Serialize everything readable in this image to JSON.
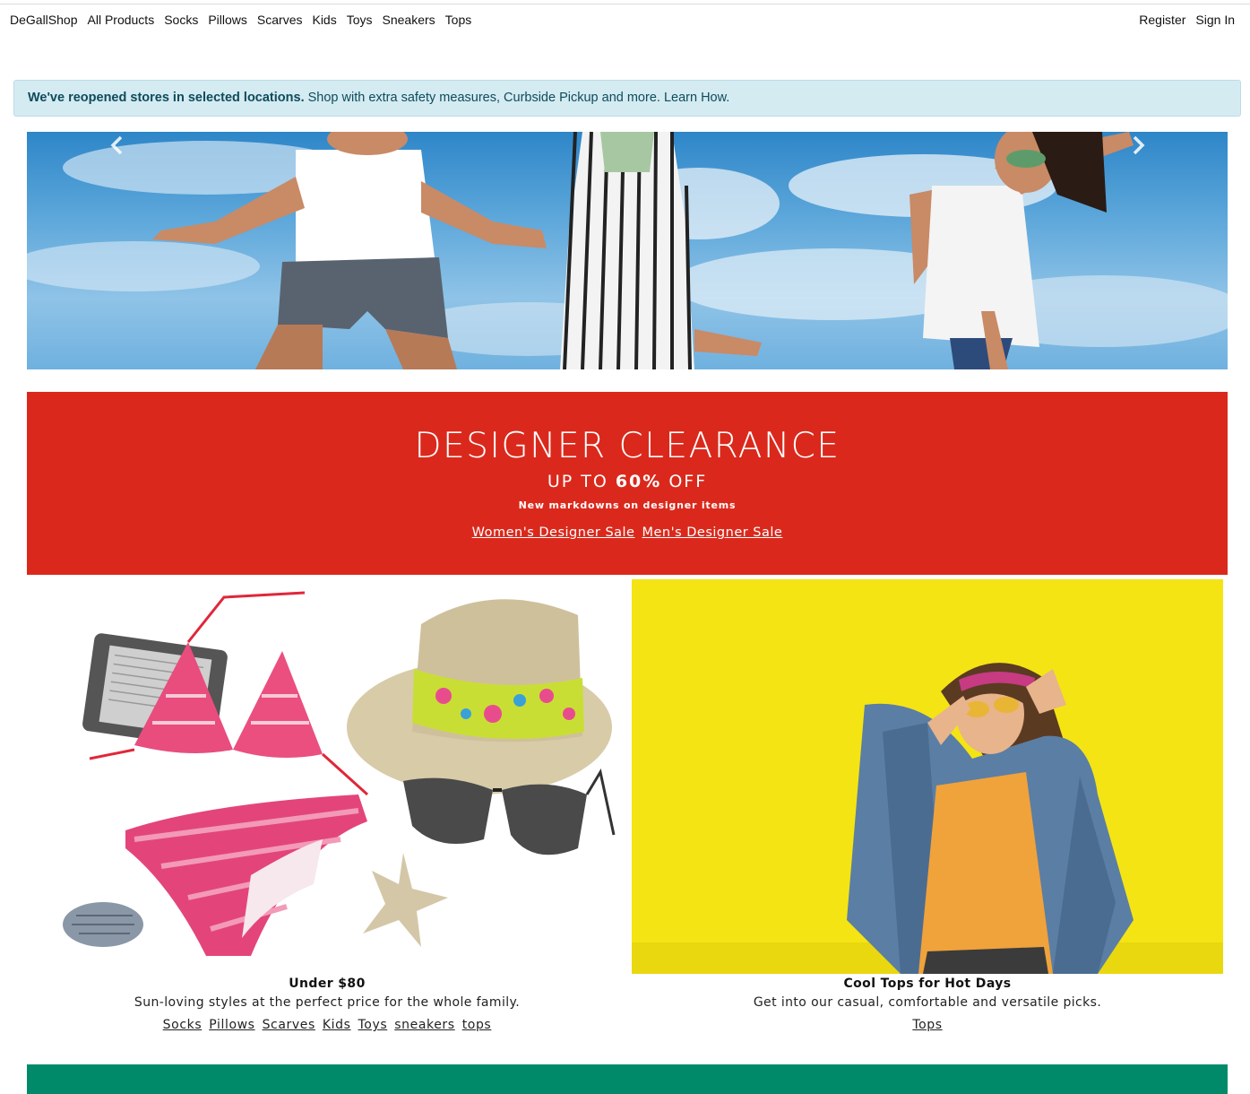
{
  "nav": {
    "brand": "DeGallShop",
    "items": [
      "All Products",
      "Socks",
      "Pillows",
      "Scarves",
      "Kids",
      "Toys",
      "Sneakers",
      "Tops"
    ],
    "register": "Register",
    "sign_in": "Sign In"
  },
  "alert": {
    "bold": "We've reopened stores in selected locations.",
    "text": " Shop with extra safety measures, Curbside Pickup and more. Learn How."
  },
  "hero": {
    "prev_icon": "chevron-left-icon",
    "next_icon": "chevron-right-icon"
  },
  "promo": {
    "title": "DESIGNER CLEARANCE",
    "sub_prefix": "UP TO ",
    "sub_bold": "60%",
    "sub_suffix": " OFF",
    "small": "New markdowns on designer items",
    "links": [
      "Women's Designer Sale",
      "Men's Designer Sale"
    ],
    "color": "#da291c"
  },
  "cards": [
    {
      "title": "Under $80",
      "desc": "Sun-loving styles at the perfect price for the whole family.",
      "links": [
        "Socks",
        "Pillows",
        "Scarves",
        "Kids",
        "Toys",
        "sneakers",
        "tops"
      ]
    },
    {
      "title": "Cool Tops for Hot Days",
      "desc": "Get into our casual, comfortable and versatile picks.",
      "links": [
        "Tops"
      ]
    }
  ],
  "colors": {
    "alert_bg": "#d4ebf2",
    "green_band": "#008a6a",
    "yellow": "#f3e312"
  }
}
